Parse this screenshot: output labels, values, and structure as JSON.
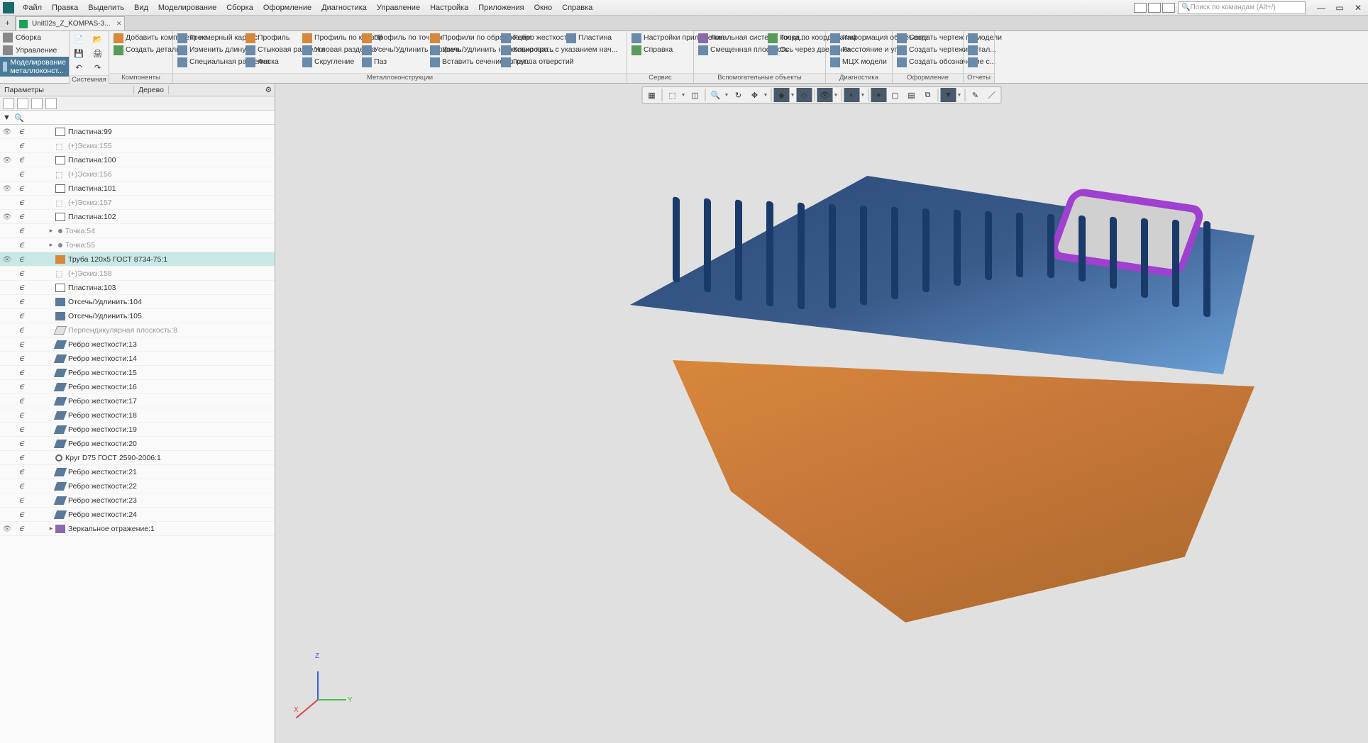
{
  "menu": [
    "Файл",
    "Правка",
    "Выделить",
    "Вид",
    "Моделирование",
    "Сборка",
    "Оформление",
    "Диагностика",
    "Управление",
    "Настройка",
    "Приложения",
    "Окно",
    "Справка"
  ],
  "search_placeholder": "Поиск по командам (Alt+/)",
  "tab_title": "Unit02s_Z_KOMPAS-3...",
  "ribbon_left": {
    "assembly": "Сборка",
    "manage": "Управление",
    "modeling": "Моделирование металлоконст..."
  },
  "groups": {
    "system": "Системная",
    "components": "Компоненты",
    "metalwork": "Металлоконструкции",
    "service": "Сервис",
    "aux": "Вспомогательные объекты",
    "diag": "Диагностика",
    "design": "Оформление",
    "reports": "Отчеты"
  },
  "rib": {
    "add_comp": "Добавить компонент из...",
    "create_part": "Создать деталь",
    "frame3d": "Трехмерный каркас",
    "change_len": "Изменить длину",
    "spec_cut": "Специальная разделка",
    "profile": "Профиль",
    "butt": "Стыковая разделка",
    "chamfer": "Фаска",
    "profile_curve": "Профиль по кривой",
    "angle_cut": "Угловая разделка",
    "fillet": "Скругление",
    "profile_pts": "Профиль по точкам",
    "trim_profile": "Усечь/Удлинить профиль",
    "slot": "Паз",
    "profiles_guides": "Профили по образующим",
    "trim_multi": "Усечь/Удлинить несколько про...",
    "insert_section": "Вставить сечение из кат...",
    "rib": "Ребро жесткости",
    "copy_ends": "Копировать с указанием нач...",
    "hole_group": "Группа отверстий",
    "plate": "Пластина",
    "app_settings": "Настройки приложения",
    "help": "Справка",
    "lcs": "Локальная система коорд...",
    "offset_plane": "Смещенная плоскость",
    "pt_coord": "Точка по координатам",
    "axis_2pt": "Ось через две точки",
    "obj_info": "Информация об объекте",
    "dist_angle": "Расстояние и угол",
    "mcx": "МЦХ модели",
    "create_drw": "Создать чертеж по модели",
    "create_drws": "Создать чертежи детал...",
    "create_desig": "Создать обозначение с..."
  },
  "panel": {
    "params": "Параметры",
    "tree": "Дерево"
  },
  "tree": [
    {
      "ic": "plate",
      "t": "Пластина:99",
      "vis": true
    },
    {
      "ic": "sketch",
      "t": "(+)Эскиз:155",
      "dim": true
    },
    {
      "ic": "plate",
      "t": "Пластина:100",
      "vis": true
    },
    {
      "ic": "sketch",
      "t": "(+)Эскиз:156",
      "dim": true
    },
    {
      "ic": "plate",
      "t": "Пластина:101",
      "vis": true
    },
    {
      "ic": "sketch",
      "t": "(+)Эскиз:157",
      "dim": true
    },
    {
      "ic": "plate",
      "t": "Пластина:102",
      "vis": true
    },
    {
      "ic": "point",
      "t": "Точка:54",
      "dim": true,
      "exp": true
    },
    {
      "ic": "point",
      "t": "Точка:55",
      "dim": true,
      "exp": true
    },
    {
      "ic": "pipe",
      "t": "Труба 120x5 ГОСТ 8734-75:1",
      "vis": true,
      "sel": true
    },
    {
      "ic": "sketch",
      "t": "(+)Эскиз:158",
      "dim": true
    },
    {
      "ic": "plate",
      "t": "Пластина:103"
    },
    {
      "ic": "trim",
      "t": "Отсечь/Удлинить:104"
    },
    {
      "ic": "trim",
      "t": "Отсечь/Удлинить:105"
    },
    {
      "ic": "plane",
      "t": "Перпендикулярная плоскость:8",
      "dim": true
    },
    {
      "ic": "rib",
      "t": "Ребро жесткости:13"
    },
    {
      "ic": "rib",
      "t": "Ребро жесткости:14"
    },
    {
      "ic": "rib",
      "t": "Ребро жесткости:15"
    },
    {
      "ic": "rib",
      "t": "Ребро жесткости:16"
    },
    {
      "ic": "rib",
      "t": "Ребро жесткости:17"
    },
    {
      "ic": "rib",
      "t": "Ребро жесткости:18"
    },
    {
      "ic": "rib",
      "t": "Ребро жесткости:19"
    },
    {
      "ic": "rib",
      "t": "Ребро жесткости:20"
    },
    {
      "ic": "circle",
      "t": "Круг D75 ГОСТ 2590-2006:1"
    },
    {
      "ic": "rib",
      "t": "Ребро жесткости:21"
    },
    {
      "ic": "rib",
      "t": "Ребро жесткости:22"
    },
    {
      "ic": "rib",
      "t": "Ребро жесткости:23"
    },
    {
      "ic": "rib",
      "t": "Ребро жесткости:24"
    },
    {
      "ic": "mirror",
      "t": "Зеркальное отражение:1",
      "vis": true,
      "exp": true
    }
  ],
  "axes": {
    "x": "X",
    "y": "Y",
    "z": "Z"
  }
}
